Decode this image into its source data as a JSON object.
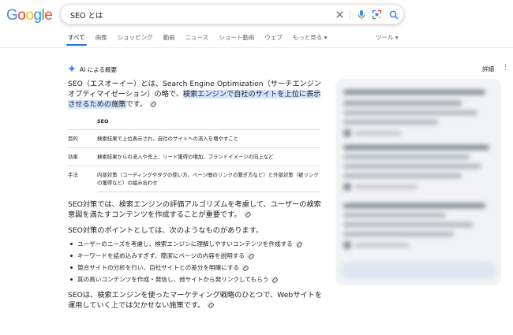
{
  "logo": {
    "letters": [
      "G",
      "o",
      "o",
      "g",
      "l",
      "e"
    ],
    "colors": [
      "#4285F4",
      "#EA4335",
      "#FBBC05",
      "#4285F4",
      "#34A853",
      "#EA4335"
    ]
  },
  "search": {
    "query": "SEO とは"
  },
  "icons": {
    "clear": "close-icon",
    "voice": "microphone-icon",
    "lens": "lens-icon",
    "search": "search-icon"
  },
  "tabs": [
    {
      "label": "すべて",
      "active": true
    },
    {
      "label": "画像"
    },
    {
      "label": "ショッピング"
    },
    {
      "label": "動画"
    },
    {
      "label": "ニュース"
    },
    {
      "label": "ショート動画"
    },
    {
      "label": "ウェブ"
    },
    {
      "label": "もっと見る ▾"
    }
  ],
  "tools_label": "ツール ▾",
  "ai": {
    "header": "AI による概要",
    "detail_label": "詳細",
    "intro_before": "SEO（エスオーイー）とは、Search Engine Optimization（サーチエンジンオプティマイゼーション）の略で、",
    "intro_highlight": "検索エンジンで自社のサイトを上位に表示させるための施策",
    "intro_after": "です。",
    "table": {
      "header": [
        "",
        "SEO"
      ],
      "rows": [
        [
          "目的",
          "検索結果で上位表示され、自社のサイトへの流入を増やすこと"
        ],
        [
          "効果",
          "検索結果からの流入や売上、リード獲得の増加、ブランドイメージの向上など"
        ],
        [
          "手法",
          "内部対策（コーディングやタグの使い方、ページ間のリンクの繋ぎ方など）と外部対策（被リンクの獲得など）の組み合わせ"
        ]
      ]
    },
    "para2": "SEO対策では、検索エンジンの評価アルゴリズムを考慮して、ユーザーの検索意図を満たすコンテンツを作成することが重要です。",
    "para3": "SEO対策のポイントとしては、次のようなものがあります。",
    "points": [
      "ユーザーのニーズを考慮し、検索エンジンに理解しやすいコンテンツを作成する",
      "キーワードを詰め込みすぎず、簡潔にページの内容を説明する",
      "競合サイトの分析を行い、自社サイトとの差分を明確にする",
      "質の高いコンテンツを作成・発信し、他サイトから発リンクしてもらう"
    ],
    "para4": "SEOは、検索エンジンを使ったマーケティング戦略のひとつで、Webサイトを運用していく上では欠かせない施策です。"
  },
  "colors": {
    "accent": "#1a73e8",
    "highlight": "#d3e3fd"
  }
}
